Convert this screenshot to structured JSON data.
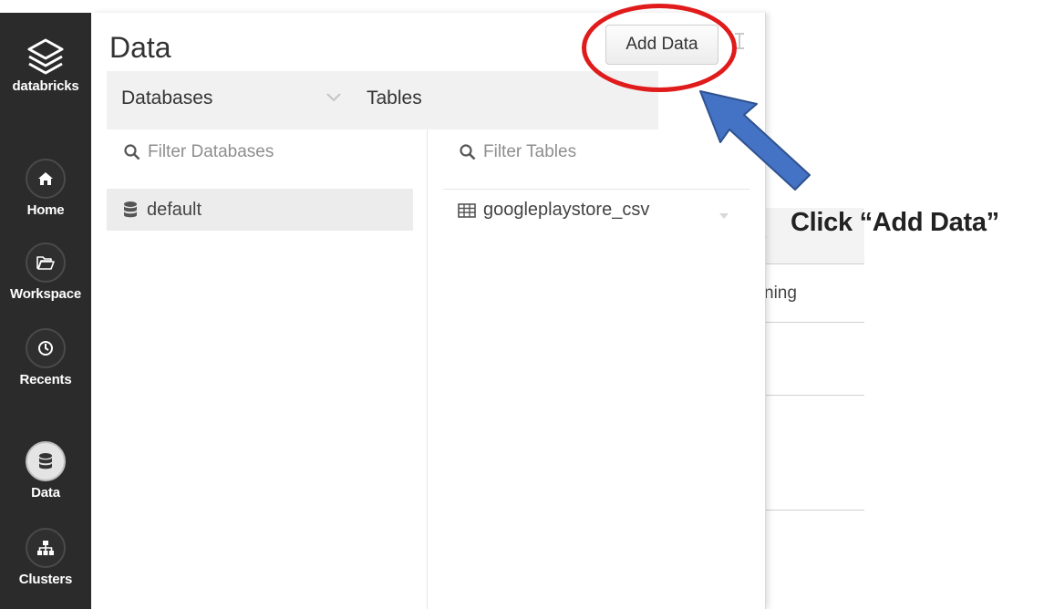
{
  "sidebar": {
    "logo_text": "databricks",
    "items": [
      {
        "label": "Home",
        "icon": "home-icon"
      },
      {
        "label": "Workspace",
        "icon": "folder-open-icon"
      },
      {
        "label": "Recents",
        "icon": "clock-icon"
      },
      {
        "label": "Data",
        "icon": "database-icon",
        "active": true
      },
      {
        "label": "Clusters",
        "icon": "sitemap-icon"
      }
    ]
  },
  "data_panel": {
    "title": "Data",
    "add_data_label": "Add Data",
    "databases": {
      "header": "Databases",
      "filter_placeholder": "Filter Databases",
      "items": [
        "default"
      ],
      "selected": "default"
    },
    "tables": {
      "header": "Tables",
      "filter_placeholder": "Filter Tables",
      "items": [
        "googleplaystore_csv"
      ]
    }
  },
  "background_page": {
    "header_fragment": "e",
    "cell_fragment": "ning"
  },
  "annotation": {
    "text": "Click “Add Data”",
    "circle_color": "#e01b1b",
    "arrow_color": "#4472c4"
  },
  "colors": {
    "sidebar_bg": "#2b2b2b",
    "header_bg": "#f1f1f1",
    "selected_row_bg": "#ececec"
  }
}
